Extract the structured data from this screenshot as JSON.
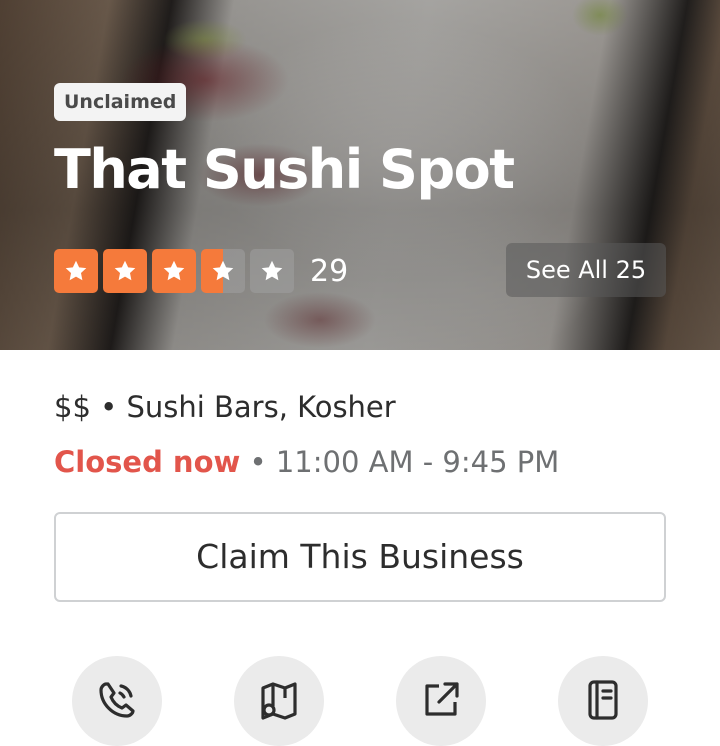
{
  "business": {
    "claim_status": "Unclaimed",
    "name": "That Sushi Spot",
    "rating": 3.5,
    "rating_max": 5,
    "review_count": "29",
    "photos_button": "See All 25",
    "price": "$$",
    "categories": "Sushi Bars, Kosher",
    "category_line": "$$ • Sushi Bars, Kosher",
    "status": "Closed now",
    "separator": " • ",
    "hours": "11:00 AM - 9:45 PM",
    "claim_button": "Claim This Business"
  },
  "actions": [
    {
      "icon": "phone-icon"
    },
    {
      "icon": "map-icon"
    },
    {
      "icon": "external-link-icon"
    },
    {
      "icon": "menu-icon"
    }
  ],
  "colors": {
    "star_active": "#f57a3b",
    "closed": "#e2554b"
  }
}
